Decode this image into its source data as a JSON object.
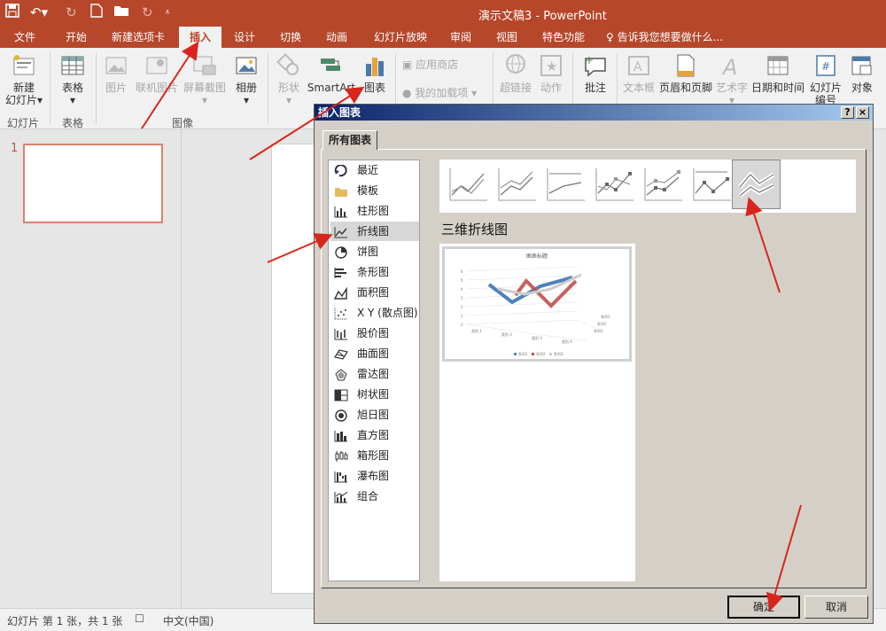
{
  "window": {
    "title": "演示文稿3 - PowerPoint"
  },
  "tabs": [
    "文件",
    "开始",
    "新建选项卡",
    "插入",
    "设计",
    "切换",
    "动画",
    "幻灯片放映",
    "审阅",
    "视图",
    "特色功能"
  ],
  "tell_me": "告诉我您想要做什么...",
  "ribbon": {
    "new_slide": "新建\n幻灯片",
    "table": "表格",
    "picture": "图片",
    "online_picture": "联机图片",
    "screenshot": "屏幕截图",
    "album": "相册",
    "shapes": "形状",
    "smartart": "SmartArt",
    "chart": "图表",
    "app_store": "应用商店",
    "my_addins": "我的加载项",
    "hyperlink": "超链接",
    "action": "动作",
    "comment": "批注",
    "textbox": "文本框",
    "header_footer": "页眉和页脚",
    "wordart": "艺术字",
    "datetime": "日期和时间",
    "slide_number": "幻灯片\n编号",
    "object": "对象",
    "groups": {
      "slides": "幻灯片",
      "tables": "表格",
      "images": "图像"
    }
  },
  "thumbnail": {
    "number": "1"
  },
  "status": {
    "slide_info": "幻灯片 第 1 张，共 1 张",
    "language": "中文(中国)"
  },
  "dialog": {
    "title": "插入图表",
    "help": "?",
    "close": "×",
    "tab": "所有图表",
    "categories": [
      "最近",
      "模板",
      "柱形图",
      "折线图",
      "饼图",
      "条形图",
      "面积图",
      "X Y (散点图)",
      "股价图",
      "曲面图",
      "雷达图",
      "树状图",
      "旭日图",
      "直方图",
      "箱形图",
      "瀑布图",
      "组合"
    ],
    "selected_category": "折线图",
    "subtype_title": "三维折线图",
    "preview": {
      "chart_title": "图表标题",
      "categories": [
        "类别 1",
        "类别 2",
        "类别 3",
        "类别 4"
      ],
      "series": [
        "系列1",
        "系列2",
        "系列3"
      ],
      "ylabels": [
        "0",
        "1",
        "2",
        "3",
        "4",
        "5",
        "6"
      ]
    },
    "ok": "确定",
    "cancel": "取消"
  },
  "colors": {
    "accent": "#b7472a",
    "dialog_bg": "#d4d0c8",
    "arrow": "#d9261c"
  }
}
